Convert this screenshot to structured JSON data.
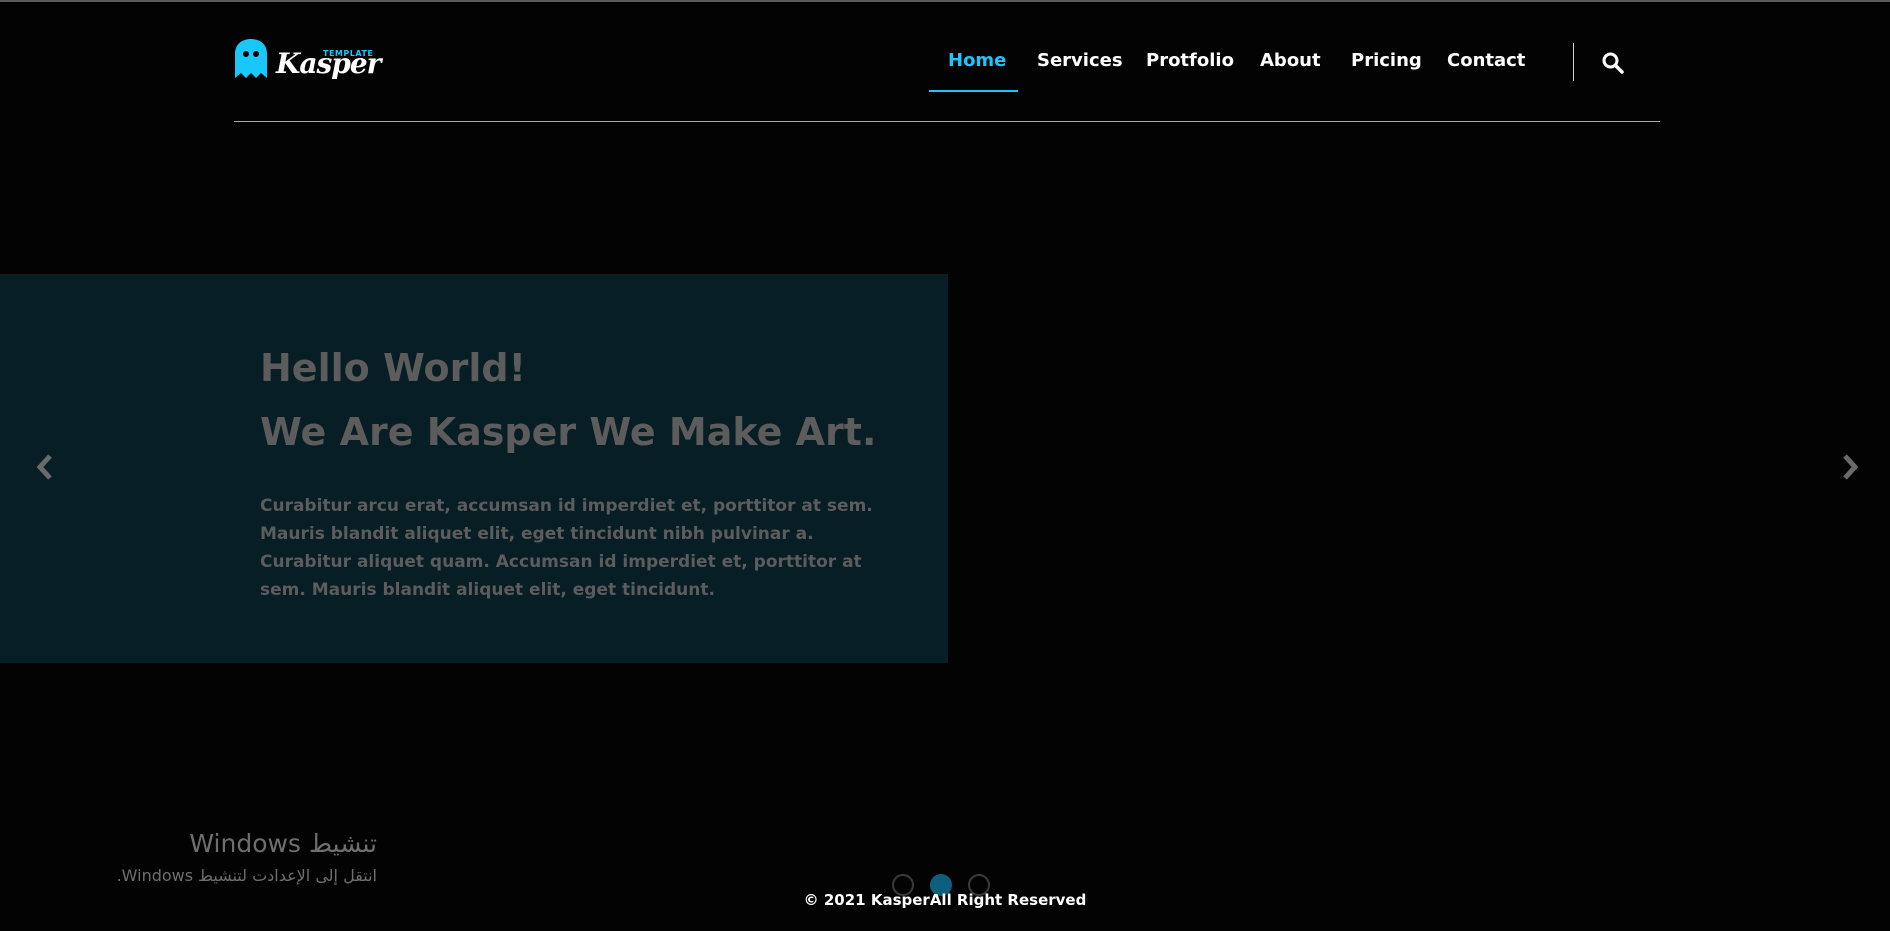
{
  "brand": {
    "tagline": "TEMPLATE",
    "name": "Kasper",
    "accent_color": "#19c8fa"
  },
  "nav": {
    "items": [
      {
        "label": "Home",
        "active": true
      },
      {
        "label": "Services",
        "active": false
      },
      {
        "label": "Protfolio",
        "active": false
      },
      {
        "label": "About",
        "active": false
      },
      {
        "label": "Pricing",
        "active": false
      },
      {
        "label": "Contact",
        "active": false
      }
    ],
    "search_icon": "search-icon"
  },
  "hero": {
    "title_line1": "Hello World!",
    "title_line2": "We Are Kasper We Make Art.",
    "paragraph": "Curabitur arcu erat, accumsan id imperdiet et, porttitor at sem. Mauris blandit aliquet elit, eget tincidunt nibh pulvinar a. Curabitur aliquet quam. Accumsan id imperdiet et, porttitor at sem. Mauris blandit aliquet elit, eget tincidunt.",
    "box_color": "#071e24",
    "prev_icon": "chevron-left-icon",
    "next_icon": "chevron-right-icon"
  },
  "slider": {
    "dots": 3,
    "active_dot": 2
  },
  "footer": {
    "copyright": "© 2021 KasperAll Right Reserved"
  },
  "os_watermark": {
    "title": "تنشيط Windows",
    "subtitle": "انتقل إلى الإعدادت لتنشيط Windows."
  }
}
